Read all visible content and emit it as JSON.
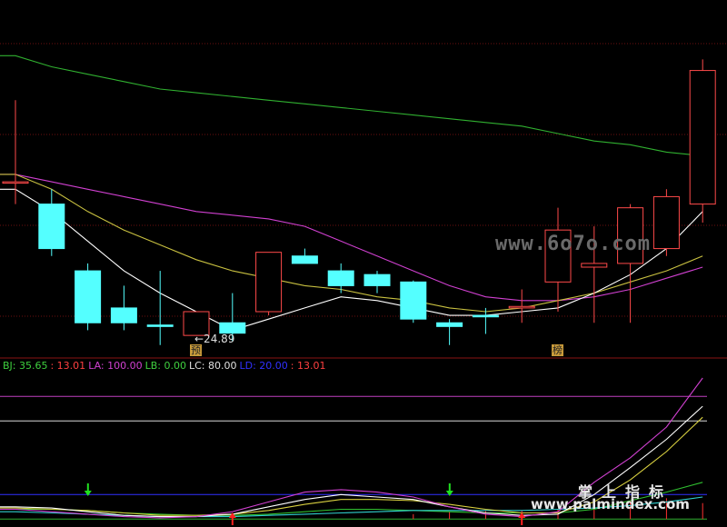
{
  "chart_data": {
    "type": "candlestick",
    "panels": [
      {
        "name": "price",
        "candles": [
          {
            "o": 26.9,
            "h": 28.0,
            "l": 26.6,
            "c": 26.9
          },
          {
            "o": 26.6,
            "h": 26.8,
            "l": 25.9,
            "c": 26.0
          },
          {
            "o": 25.7,
            "h": 25.8,
            "l": 24.9,
            "c": 25.0
          },
          {
            "o": 25.2,
            "h": 25.5,
            "l": 24.9,
            "c": 25.0
          },
          {
            "o": 24.97,
            "h": 25.7,
            "l": 24.7,
            "c": 24.95
          },
          {
            "o": 24.83,
            "h": 25.0,
            "l": 24.89,
            "c": 25.15
          },
          {
            "o": 25.0,
            "h": 25.4,
            "l": 24.75,
            "c": 24.86
          },
          {
            "o": 25.15,
            "h": 25.9,
            "l": 25.1,
            "c": 25.95
          },
          {
            "o": 25.9,
            "h": 26.0,
            "l": 25.8,
            "c": 25.8
          },
          {
            "o": 25.7,
            "h": 25.8,
            "l": 25.4,
            "c": 25.5
          },
          {
            "o": 25.65,
            "h": 25.7,
            "l": 25.4,
            "c": 25.5
          },
          {
            "o": 25.55,
            "h": 25.57,
            "l": 25.0,
            "c": 25.05
          },
          {
            "o": 25.0,
            "h": 25.05,
            "l": 24.7,
            "c": 24.95
          },
          {
            "o": 25.1,
            "h": 25.2,
            "l": 24.85,
            "c": 25.08
          },
          {
            "o": 25.2,
            "h": 25.45,
            "l": 25.0,
            "c": 25.22
          },
          {
            "o": 25.55,
            "h": 26.55,
            "l": 25.15,
            "c": 26.25
          },
          {
            "o": 25.75,
            "h": 26.3,
            "l": 25.0,
            "c": 25.8
          },
          {
            "o": 25.8,
            "h": 26.6,
            "l": 25.0,
            "c": 26.55
          },
          {
            "o": 26.0,
            "h": 26.8,
            "l": 25.9,
            "c": 26.7
          },
          {
            "o": 26.6,
            "h": 28.55,
            "l": 26.35,
            "c": 28.4
          }
        ],
        "ma_short": [
          26.8,
          26.5,
          26.1,
          25.7,
          25.4,
          25.15,
          24.9,
          25.05,
          25.2,
          25.35,
          25.3,
          25.2,
          25.1,
          25.1,
          25.15,
          25.2,
          25.4,
          25.65,
          26.0,
          26.5
        ],
        "ma_mid": [
          27.0,
          26.8,
          26.5,
          26.25,
          26.05,
          25.85,
          25.7,
          25.6,
          25.5,
          25.45,
          25.35,
          25.3,
          25.2,
          25.15,
          25.2,
          25.3,
          25.4,
          25.55,
          25.7,
          25.9
        ],
        "ma_slow": [
          27.0,
          26.9,
          26.8,
          26.7,
          26.6,
          26.5,
          26.45,
          26.4,
          26.3,
          26.1,
          25.9,
          25.7,
          25.5,
          25.35,
          25.3,
          25.3,
          25.35,
          25.45,
          25.6,
          25.75
        ],
        "ma_long": [
          28.6,
          28.45,
          28.35,
          28.25,
          28.15,
          28.1,
          28.05,
          28.0,
          27.95,
          27.9,
          27.85,
          27.8,
          27.75,
          27.7,
          27.65,
          27.55,
          27.45,
          27.4,
          27.3,
          27.25
        ],
        "low_label": "←24.89",
        "markers": [
          {
            "index": 5,
            "text": "预"
          },
          {
            "index": 15,
            "text": "榜"
          }
        ]
      },
      {
        "name": "indicator",
        "legend": [
          {
            "text": "BJ: 35.65",
            "color": "#3fd03f"
          },
          {
            "text": ": 13.01",
            "color": "#ff4040"
          },
          {
            "text": "LA: 100.00",
            "color": "#d040d0"
          },
          {
            "text": "LB: 0.00",
            "color": "#3fd03f"
          },
          {
            "text": "LC: 80.00",
            "color": "#e0e0e0"
          },
          {
            "text": "LD: 20.00",
            "color": "#3030ff"
          },
          {
            "text": ": 13.01",
            "color": "#ff4040"
          }
        ],
        "ylim": [
          -5,
          100
        ],
        "levels": {
          "LA": 100,
          "LB": 0,
          "LC": 80,
          "LD": 20
        },
        "series_magenta": [
          8,
          6,
          4,
          2,
          1,
          2,
          6,
          14,
          22,
          24,
          22,
          18,
          10,
          4,
          2,
          6,
          30,
          50,
          75,
          115
        ],
        "series_white": [
          10,
          9,
          6,
          3,
          2,
          2,
          4,
          10,
          16,
          20,
          18,
          16,
          10,
          5,
          3,
          4,
          20,
          42,
          65,
          92
        ],
        "series_yellow": [
          9,
          8,
          7,
          5,
          3,
          3,
          4,
          7,
          12,
          16,
          16,
          15,
          12,
          8,
          5,
          5,
          14,
          32,
          55,
          83
        ],
        "series_green": [
          8,
          8,
          7,
          5,
          4,
          3,
          3,
          4,
          6,
          8,
          8,
          7,
          6,
          5,
          5,
          5,
          8,
          15,
          22,
          30
        ],
        "series_cyan": [
          6,
          5,
          4,
          3,
          2,
          2,
          2,
          3,
          4,
          5,
          6,
          7,
          7,
          7,
          7,
          8,
          9,
          11,
          14,
          18
        ],
        "bars": [
          0,
          0,
          0,
          0,
          0,
          0,
          0,
          0,
          0,
          0,
          0,
          4,
          6,
          7,
          7,
          8,
          12,
          15,
          17,
          13.01
        ],
        "arrows_up": [
          {
            "index": 6,
            "color": "#ff2020"
          },
          {
            "index": 14,
            "color": "#ff2020"
          }
        ],
        "arrows_down": [
          {
            "index": 1,
            "color": "#20e020"
          },
          {
            "index": 11,
            "color": "#20e020"
          }
        ]
      }
    ]
  },
  "watermarks": {
    "top": "www.6o7o.com",
    "bottom_title": "掌上指标",
    "bottom_url": "www.palmindex.com"
  },
  "colors": {
    "bull": "#ff4a4a",
    "bear": "#54ffff",
    "ma_short": "#ffffff",
    "ma_mid": "#c8c040",
    "ma_slow": "#d040d0",
    "ma_long": "#30b030",
    "grid": "#6b1010"
  }
}
